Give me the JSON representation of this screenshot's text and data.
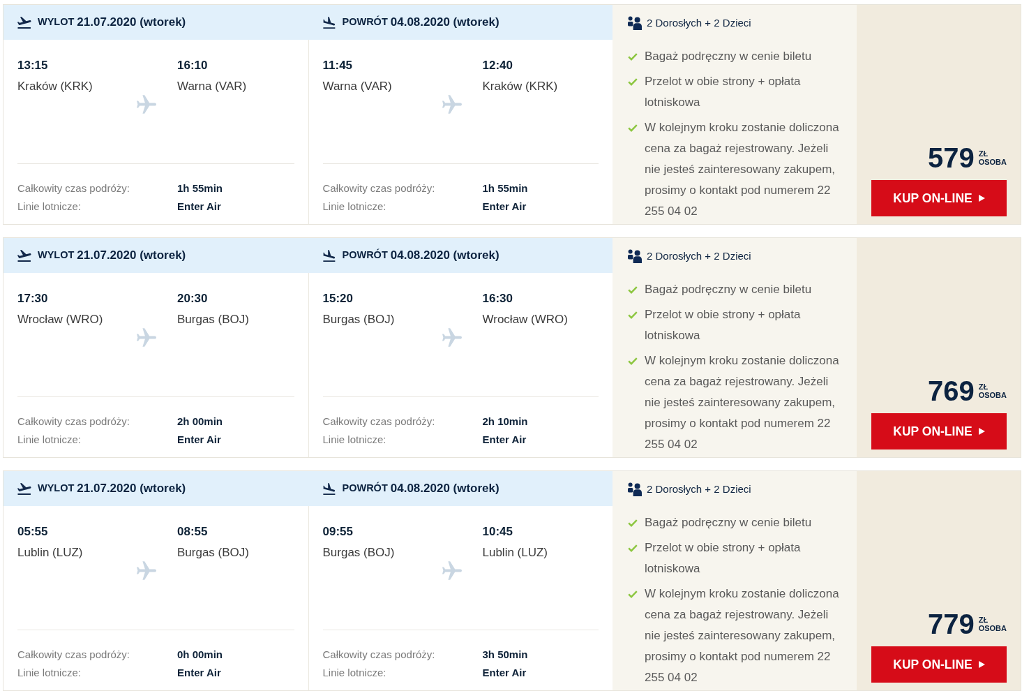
{
  "offers": [
    {
      "legs": [
        {
          "kind": "outbound",
          "label": "WYLOT",
          "date": "21.07.2020 (wtorek)",
          "departure": {
            "time": "13:15",
            "place": "Kraków (KRK)"
          },
          "arrival": {
            "time": "16:10",
            "place": "Warna (VAR)"
          },
          "details": [
            {
              "label": "Całkowity czas podróży:",
              "value": "1h 55min"
            },
            {
              "label": "Linie lotnicze:",
              "value": "Enter Air"
            }
          ]
        },
        {
          "kind": "return",
          "label": "POWRÓT",
          "date": "04.08.2020 (wtorek)",
          "departure": {
            "time": "11:45",
            "place": "Warna (VAR)"
          },
          "arrival": {
            "time": "12:40",
            "place": "Kraków (KRK)"
          },
          "details": [
            {
              "label": "Całkowity czas podróży:",
              "value": "1h 55min"
            },
            {
              "label": "Linie lotnicze:",
              "value": "Enter Air"
            }
          ]
        }
      ],
      "passengers": "2 Dorosłych + 2 Dzieci",
      "features": [
        "Bagaż podręczny w cenie biletu",
        "Przelot w obie strony + opłata lotniskowa",
        "W kolejnym kroku zostanie doliczona cena za bagaż rejestrowany. Jeżeli nie jesteś zainteresowany zakupem, prosimy o kontakt pod numerem 22 255 04 02"
      ],
      "price": {
        "amount": "579",
        "currency": "ZŁ",
        "unit": "OSOBA"
      },
      "button": "KUP ON-LINE"
    },
    {
      "legs": [
        {
          "kind": "outbound",
          "label": "WYLOT",
          "date": "21.07.2020 (wtorek)",
          "departure": {
            "time": "17:30",
            "place": "Wrocław (WRO)"
          },
          "arrival": {
            "time": "20:30",
            "place": "Burgas (BOJ)"
          },
          "details": [
            {
              "label": "Całkowity czas podróży:",
              "value": "2h 00min"
            },
            {
              "label": "Linie lotnicze:",
              "value": "Enter Air"
            }
          ]
        },
        {
          "kind": "return",
          "label": "POWRÓT",
          "date": "04.08.2020 (wtorek)",
          "departure": {
            "time": "15:20",
            "place": "Burgas (BOJ)"
          },
          "arrival": {
            "time": "16:30",
            "place": "Wrocław (WRO)"
          },
          "details": [
            {
              "label": "Całkowity czas podróży:",
              "value": "2h 10min"
            },
            {
              "label": "Linie lotnicze:",
              "value": "Enter Air"
            }
          ]
        }
      ],
      "passengers": "2 Dorosłych + 2 Dzieci",
      "features": [
        "Bagaż podręczny w cenie biletu",
        "Przelot w obie strony + opłata lotniskowa",
        "W kolejnym kroku zostanie doliczona cena za bagaż rejestrowany. Jeżeli nie jesteś zainteresowany zakupem, prosimy o kontakt pod numerem 22 255 04 02"
      ],
      "price": {
        "amount": "769",
        "currency": "ZŁ",
        "unit": "OSOBA"
      },
      "button": "KUP ON-LINE"
    },
    {
      "legs": [
        {
          "kind": "outbound",
          "label": "WYLOT",
          "date": "21.07.2020 (wtorek)",
          "departure": {
            "time": "05:55",
            "place": "Lublin (LUZ)"
          },
          "arrival": {
            "time": "08:55",
            "place": "Burgas (BOJ)"
          },
          "details": [
            {
              "label": "Całkowity czas podróży:",
              "value": "0h 00min"
            },
            {
              "label": "Linie lotnicze:",
              "value": "Enter Air"
            }
          ]
        },
        {
          "kind": "return",
          "label": "POWRÓT",
          "date": "04.08.2020 (wtorek)",
          "departure": {
            "time": "09:55",
            "place": "Burgas (BOJ)"
          },
          "arrival": {
            "time": "10:45",
            "place": "Lublin (LUZ)"
          },
          "details": [
            {
              "label": "Całkowity czas podróży:",
              "value": "3h 50min"
            },
            {
              "label": "Linie lotnicze:",
              "value": "Enter Air"
            }
          ]
        }
      ],
      "passengers": "2 Dorosłych + 2 Dzieci",
      "features": [
        "Bagaż podręczny w cenie biletu",
        "Przelot w obie strony + opłata lotniskowa",
        "W kolejnym kroku zostanie doliczona cena za bagaż rejestrowany. Jeżeli nie jesteś zainteresowany zakupem, prosimy o kontakt pod numerem 22 255 04 02"
      ],
      "price": {
        "amount": "779",
        "currency": "ZŁ",
        "unit": "OSOBA"
      },
      "button": "KUP ON-LINE"
    }
  ]
}
